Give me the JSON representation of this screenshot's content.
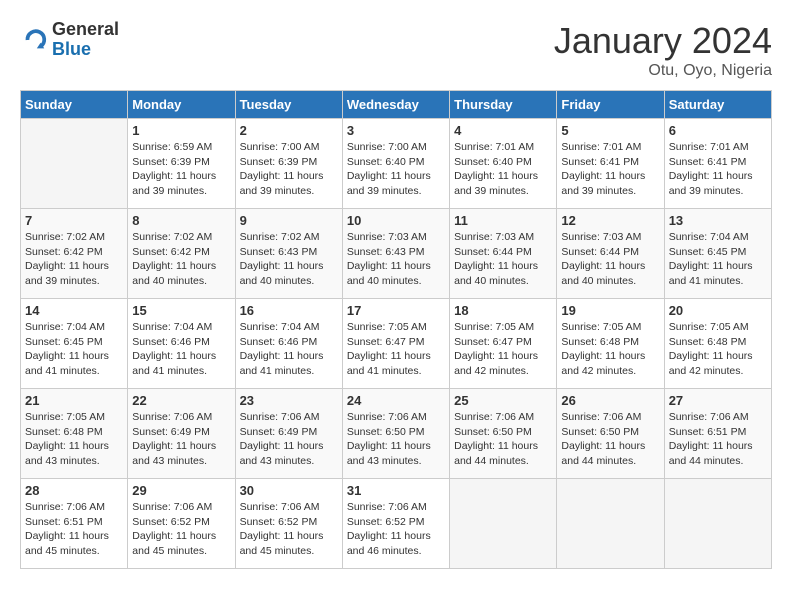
{
  "logo": {
    "general": "General",
    "blue": "Blue"
  },
  "title": "January 2024",
  "location": "Otu, Oyo, Nigeria",
  "days_of_week": [
    "Sunday",
    "Monday",
    "Tuesday",
    "Wednesday",
    "Thursday",
    "Friday",
    "Saturday"
  ],
  "weeks": [
    [
      {
        "num": "",
        "info": ""
      },
      {
        "num": "1",
        "info": "Sunrise: 6:59 AM\nSunset: 6:39 PM\nDaylight: 11 hours\nand 39 minutes."
      },
      {
        "num": "2",
        "info": "Sunrise: 7:00 AM\nSunset: 6:39 PM\nDaylight: 11 hours\nand 39 minutes."
      },
      {
        "num": "3",
        "info": "Sunrise: 7:00 AM\nSunset: 6:40 PM\nDaylight: 11 hours\nand 39 minutes."
      },
      {
        "num": "4",
        "info": "Sunrise: 7:01 AM\nSunset: 6:40 PM\nDaylight: 11 hours\nand 39 minutes."
      },
      {
        "num": "5",
        "info": "Sunrise: 7:01 AM\nSunset: 6:41 PM\nDaylight: 11 hours\nand 39 minutes."
      },
      {
        "num": "6",
        "info": "Sunrise: 7:01 AM\nSunset: 6:41 PM\nDaylight: 11 hours\nand 39 minutes."
      }
    ],
    [
      {
        "num": "7",
        "info": "Sunrise: 7:02 AM\nSunset: 6:42 PM\nDaylight: 11 hours\nand 39 minutes."
      },
      {
        "num": "8",
        "info": "Sunrise: 7:02 AM\nSunset: 6:42 PM\nDaylight: 11 hours\nand 40 minutes."
      },
      {
        "num": "9",
        "info": "Sunrise: 7:02 AM\nSunset: 6:43 PM\nDaylight: 11 hours\nand 40 minutes."
      },
      {
        "num": "10",
        "info": "Sunrise: 7:03 AM\nSunset: 6:43 PM\nDaylight: 11 hours\nand 40 minutes."
      },
      {
        "num": "11",
        "info": "Sunrise: 7:03 AM\nSunset: 6:44 PM\nDaylight: 11 hours\nand 40 minutes."
      },
      {
        "num": "12",
        "info": "Sunrise: 7:03 AM\nSunset: 6:44 PM\nDaylight: 11 hours\nand 40 minutes."
      },
      {
        "num": "13",
        "info": "Sunrise: 7:04 AM\nSunset: 6:45 PM\nDaylight: 11 hours\nand 41 minutes."
      }
    ],
    [
      {
        "num": "14",
        "info": "Sunrise: 7:04 AM\nSunset: 6:45 PM\nDaylight: 11 hours\nand 41 minutes."
      },
      {
        "num": "15",
        "info": "Sunrise: 7:04 AM\nSunset: 6:46 PM\nDaylight: 11 hours\nand 41 minutes."
      },
      {
        "num": "16",
        "info": "Sunrise: 7:04 AM\nSunset: 6:46 PM\nDaylight: 11 hours\nand 41 minutes."
      },
      {
        "num": "17",
        "info": "Sunrise: 7:05 AM\nSunset: 6:47 PM\nDaylight: 11 hours\nand 41 minutes."
      },
      {
        "num": "18",
        "info": "Sunrise: 7:05 AM\nSunset: 6:47 PM\nDaylight: 11 hours\nand 42 minutes."
      },
      {
        "num": "19",
        "info": "Sunrise: 7:05 AM\nSunset: 6:48 PM\nDaylight: 11 hours\nand 42 minutes."
      },
      {
        "num": "20",
        "info": "Sunrise: 7:05 AM\nSunset: 6:48 PM\nDaylight: 11 hours\nand 42 minutes."
      }
    ],
    [
      {
        "num": "21",
        "info": "Sunrise: 7:05 AM\nSunset: 6:48 PM\nDaylight: 11 hours\nand 43 minutes."
      },
      {
        "num": "22",
        "info": "Sunrise: 7:06 AM\nSunset: 6:49 PM\nDaylight: 11 hours\nand 43 minutes."
      },
      {
        "num": "23",
        "info": "Sunrise: 7:06 AM\nSunset: 6:49 PM\nDaylight: 11 hours\nand 43 minutes."
      },
      {
        "num": "24",
        "info": "Sunrise: 7:06 AM\nSunset: 6:50 PM\nDaylight: 11 hours\nand 43 minutes."
      },
      {
        "num": "25",
        "info": "Sunrise: 7:06 AM\nSunset: 6:50 PM\nDaylight: 11 hours\nand 44 minutes."
      },
      {
        "num": "26",
        "info": "Sunrise: 7:06 AM\nSunset: 6:50 PM\nDaylight: 11 hours\nand 44 minutes."
      },
      {
        "num": "27",
        "info": "Sunrise: 7:06 AM\nSunset: 6:51 PM\nDaylight: 11 hours\nand 44 minutes."
      }
    ],
    [
      {
        "num": "28",
        "info": "Sunrise: 7:06 AM\nSunset: 6:51 PM\nDaylight: 11 hours\nand 45 minutes."
      },
      {
        "num": "29",
        "info": "Sunrise: 7:06 AM\nSunset: 6:52 PM\nDaylight: 11 hours\nand 45 minutes."
      },
      {
        "num": "30",
        "info": "Sunrise: 7:06 AM\nSunset: 6:52 PM\nDaylight: 11 hours\nand 45 minutes."
      },
      {
        "num": "31",
        "info": "Sunrise: 7:06 AM\nSunset: 6:52 PM\nDaylight: 11 hours\nand 46 minutes."
      },
      {
        "num": "",
        "info": ""
      },
      {
        "num": "",
        "info": ""
      },
      {
        "num": "",
        "info": ""
      }
    ]
  ]
}
